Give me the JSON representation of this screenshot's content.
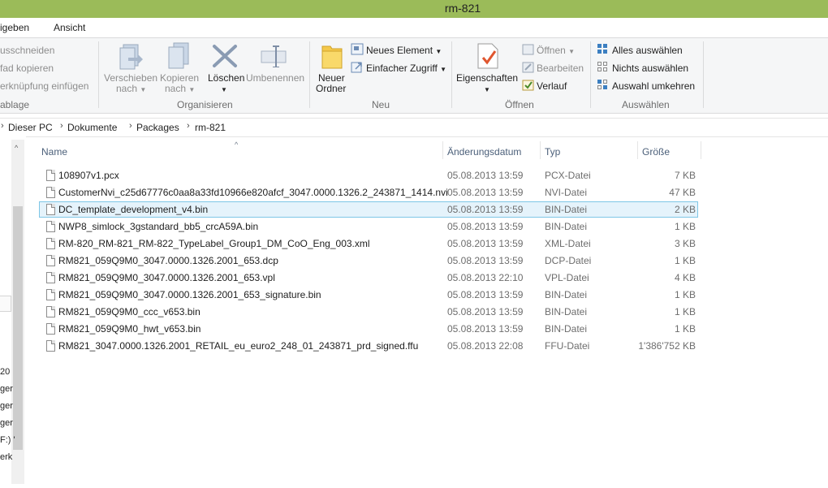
{
  "window": {
    "title": "rm-821"
  },
  "ribbon_tabs": [
    "igeben",
    "Ansicht"
  ],
  "ribbon": {
    "clipboard": {
      "cut": "usschneiden",
      "copy_path": "fad kopieren",
      "paste_link": "erknüpfung einfügen",
      "label": "ablage"
    },
    "organize": {
      "move_line1": "Verschieben",
      "move_line2": "nach",
      "copy_line1": "Kopieren",
      "copy_line2": "nach",
      "delete": "Löschen",
      "rename": "Umbenennen",
      "label": "Organisieren"
    },
    "new": {
      "folder_line1": "Neuer",
      "folder_line2": "Ordner",
      "new_item": "Neues Element",
      "easy_access": "Einfacher Zugriff",
      "label": "Neu"
    },
    "open": {
      "properties": "Eigenschaften",
      "open": "Öffnen",
      "edit": "Bearbeiten",
      "history": "Verlauf",
      "label": "Öffnen"
    },
    "select": {
      "select_all": "Alles auswählen",
      "select_none": "Nichts auswählen",
      "invert": "Auswahl umkehren",
      "label": "Auswählen"
    }
  },
  "breadcrumb": [
    "Dieser PC",
    "Dokumente",
    "Packages",
    "rm-821"
  ],
  "nav_fragments": [
    "20",
    "ger",
    "ger",
    "ger",
    "F:) '",
    "erk"
  ],
  "columns": {
    "name": "Name",
    "date": "Änderungsdatum",
    "type": "Typ",
    "size": "Größe"
  },
  "files": [
    {
      "name": "108907v1.pcx",
      "date": "05.08.2013 13:59",
      "type": "PCX-Datei",
      "size": "7 KB"
    },
    {
      "name": "CustomerNvi_c25d67776c0aa8a33fd10966e820afcf_3047.0000.1326.2_243871_1414.nvi",
      "date": "05.08.2013 13:59",
      "type": "NVI-Datei",
      "size": "47 KB"
    },
    {
      "name": "DC_template_development_v4.bin",
      "date": "05.08.2013 13:59",
      "type": "BIN-Datei",
      "size": "2 KB"
    },
    {
      "name": "NWP8_simlock_3gstandard_bb5_crcA59A.bin",
      "date": "05.08.2013 13:59",
      "type": "BIN-Datei",
      "size": "1 KB"
    },
    {
      "name": "RM-820_RM-821_RM-822_TypeLabel_Group1_DM_CoO_Eng_003.xml",
      "date": "05.08.2013 13:59",
      "type": "XML-Datei",
      "size": "3 KB"
    },
    {
      "name": "RM821_059Q9M0_3047.0000.1326.2001_653.dcp",
      "date": "05.08.2013 13:59",
      "type": "DCP-Datei",
      "size": "1 KB"
    },
    {
      "name": "RM821_059Q9M0_3047.0000.1326.2001_653.vpl",
      "date": "05.08.2013 22:10",
      "type": "VPL-Datei",
      "size": "4 KB"
    },
    {
      "name": "RM821_059Q9M0_3047.0000.1326.2001_653_signature.bin",
      "date": "05.08.2013 13:59",
      "type": "BIN-Datei",
      "size": "1 KB"
    },
    {
      "name": "RM821_059Q9M0_ccc_v653.bin",
      "date": "05.08.2013 13:59",
      "type": "BIN-Datei",
      "size": "1 KB"
    },
    {
      "name": "RM821_059Q9M0_hwt_v653.bin",
      "date": "05.08.2013 13:59",
      "type": "BIN-Datei",
      "size": "1 KB"
    },
    {
      "name": "RM821_3047.0000.1326.2001_RETAIL_eu_euro2_248_01_243871_prd_signed.ffu",
      "date": "05.08.2013 22:08",
      "type": "FFU-Datei",
      "size": "1'386'752 KB"
    }
  ],
  "colors": {
    "titlebar": "#9bbb59",
    "selection_bg": "#e5f3fb",
    "selection_border": "#7ec6e6"
  }
}
